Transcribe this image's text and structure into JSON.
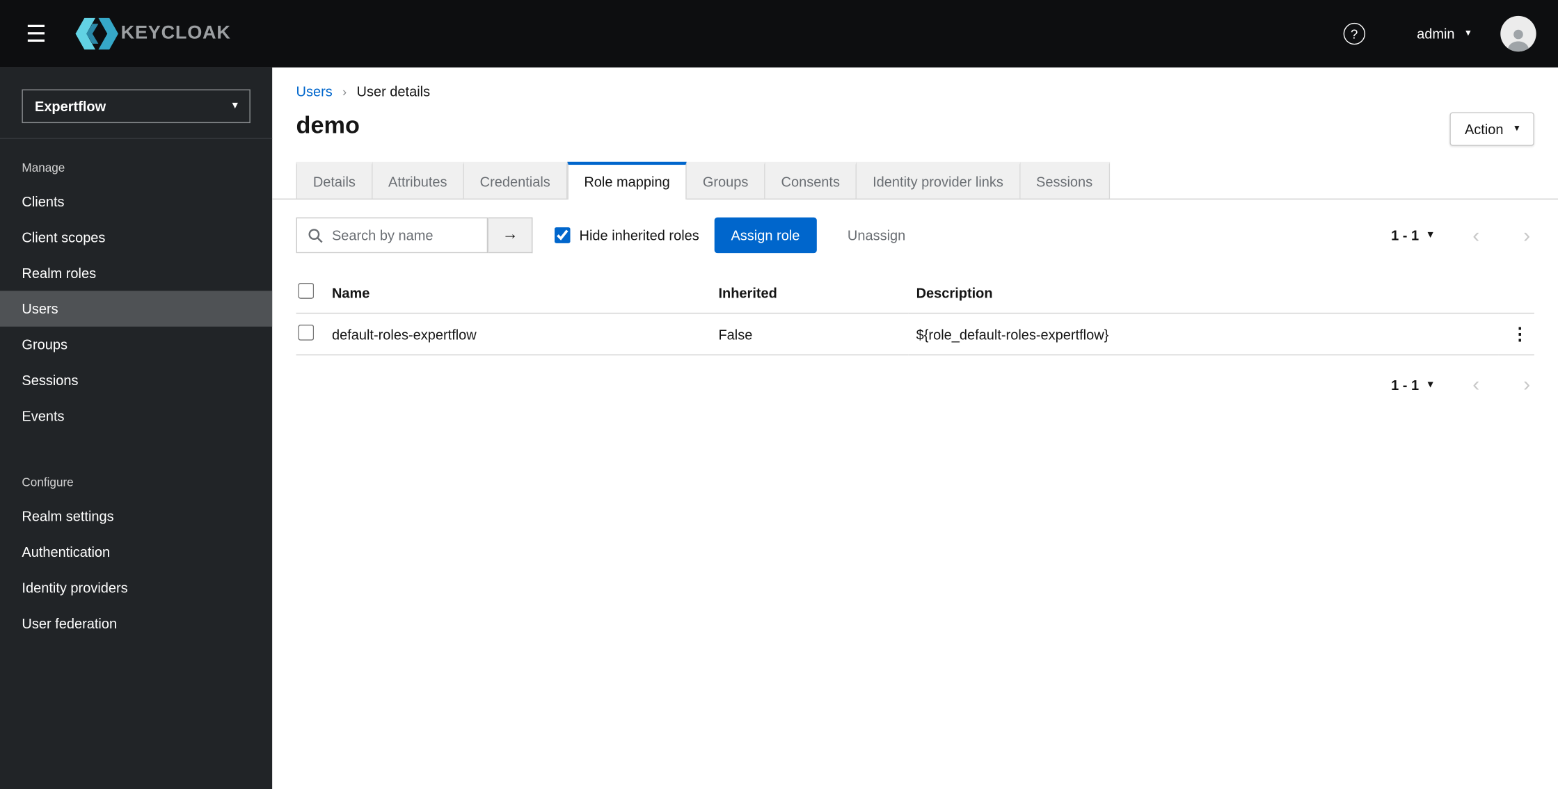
{
  "masthead": {
    "brand": "KEYCLOAK",
    "username": "admin"
  },
  "icons": {
    "hamburger": "☰",
    "caret_down": "▾",
    "breadcrumb_separator": "›",
    "arrow_right": "→",
    "kebab": "⋮",
    "chevron_left": "‹",
    "chevron_right": "›",
    "help": "?"
  },
  "sidebar": {
    "realm_selector": {
      "value": "Expertflow"
    },
    "groups": [
      {
        "label": "Manage",
        "items": [
          {
            "label": "Clients",
            "active": false
          },
          {
            "label": "Client scopes",
            "active": false
          },
          {
            "label": "Realm roles",
            "active": false
          },
          {
            "label": "Users",
            "active": true
          },
          {
            "label": "Groups",
            "active": false
          },
          {
            "label": "Sessions",
            "active": false
          },
          {
            "label": "Events",
            "active": false
          }
        ]
      },
      {
        "label": "Configure",
        "items": [
          {
            "label": "Realm settings",
            "active": false
          },
          {
            "label": "Authentication",
            "active": false
          },
          {
            "label": "Identity providers",
            "active": false
          },
          {
            "label": "User federation",
            "active": false
          }
        ]
      }
    ]
  },
  "breadcrumb": {
    "items": [
      {
        "label": "Users"
      },
      {
        "label": "User details"
      }
    ]
  },
  "page": {
    "title": "demo",
    "action_button": "Action"
  },
  "tabs": [
    {
      "label": "Details",
      "active": false
    },
    {
      "label": "Attributes",
      "active": false
    },
    {
      "label": "Credentials",
      "active": false
    },
    {
      "label": "Role mapping",
      "active": true
    },
    {
      "label": "Groups",
      "active": false
    },
    {
      "label": "Consents",
      "active": false
    },
    {
      "label": "Identity provider links",
      "active": false
    },
    {
      "label": "Sessions",
      "active": false
    }
  ],
  "toolbar": {
    "search": {
      "placeholder": "Search by name",
      "value": ""
    },
    "hide_inherited": {
      "label": "Hide inherited roles",
      "checked": true
    },
    "assign_button": "Assign role",
    "unassign_button": "Unassign"
  },
  "pagination": {
    "range": "1 - 1"
  },
  "table": {
    "headers": [
      "Name",
      "Inherited",
      "Description"
    ],
    "rows": [
      {
        "name": "default-roles-expertflow",
        "inherited": "False",
        "description": "${role_default-roles-expertflow}"
      }
    ]
  },
  "colors": {
    "accent": "#0066cc",
    "masthead_bg": "#0d0e10",
    "sidebar_bg": "#212427",
    "active_nav_bg": "#4f5255",
    "tab_inactive_bg": "#f0f0f0",
    "border": "#d2d2d2",
    "logo_cyan_light": "#62d2e4",
    "logo_cyan_dark": "#36a8c8"
  }
}
